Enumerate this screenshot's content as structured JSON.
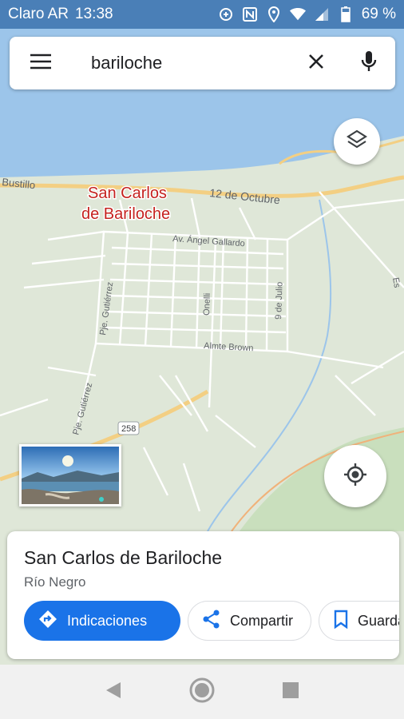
{
  "status_bar": {
    "carrier": "Claro AR",
    "time": "13:38",
    "battery": "69 %",
    "icons": [
      "data-saver-icon",
      "nfc-icon",
      "location-icon",
      "wifi-icon",
      "signal-icon",
      "battery-icon"
    ]
  },
  "search": {
    "menu_icon": "menu-icon",
    "query": "bariloche",
    "clear_icon": "close-icon",
    "voice_icon": "mic-icon"
  },
  "map": {
    "city_label_line1": "San Carlos",
    "city_label_line2": "de Bariloche",
    "streets": {
      "bustillo": "Bustillo",
      "doce_octubre": "12 de Octubre",
      "angel_gallardo": "Av. Ángel Gallardo",
      "onelli": "Onelli",
      "nueve_julio": "9 de Julio",
      "gutierrez": "Pje. Gutiérrez",
      "gutierrez2": "Pje. Gutiérrez",
      "brown": "Almte Brown",
      "route": "258",
      "east": "Es"
    },
    "colors": {
      "water": "#9cc5ea",
      "land": "#dfe7d8",
      "roads": "#ffffff",
      "major_road": "#f6d38b",
      "park": "#c8e0bf"
    }
  },
  "controls": {
    "layers_icon": "layers-icon",
    "locate_icon": "my-location-icon"
  },
  "place": {
    "name": "San Carlos de Bariloche",
    "region": "Río Negro",
    "actions": [
      {
        "label": "Indicaciones",
        "icon": "directions-icon"
      },
      {
        "label": "Compartir",
        "icon": "share-icon"
      },
      {
        "label": "Guardar",
        "icon": "bookmark-icon"
      }
    ]
  },
  "nav": {
    "back_icon": "back-icon",
    "home_icon": "home-icon",
    "recents_icon": "recents-icon"
  },
  "accent": "#1a73e8"
}
